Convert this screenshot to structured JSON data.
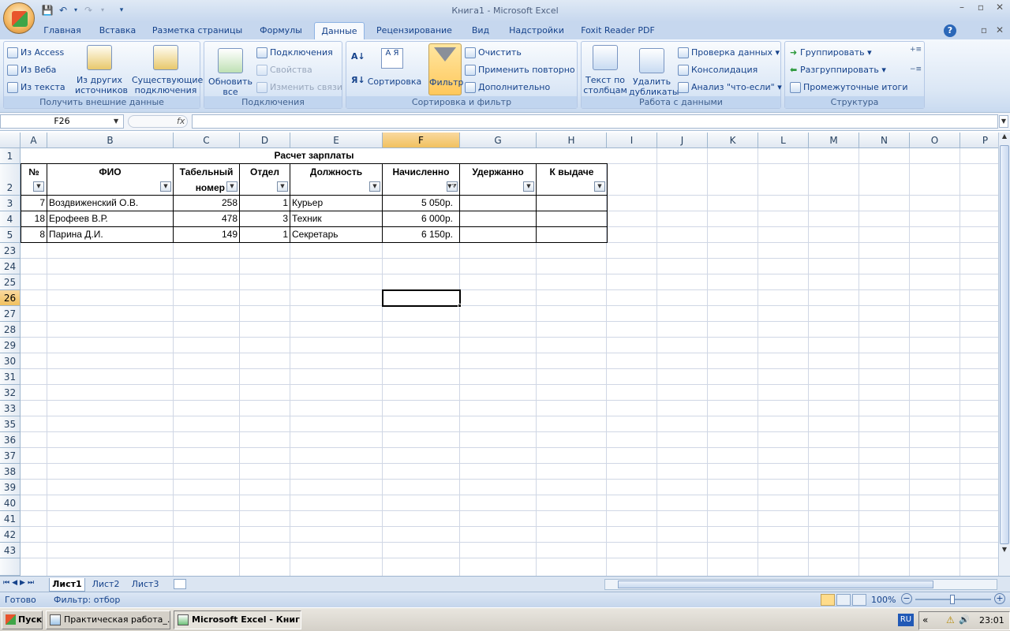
{
  "window": {
    "title": "Книга1 - Microsoft Excel"
  },
  "tabs": [
    "Главная",
    "Вставка",
    "Разметка страницы",
    "Формулы",
    "Данные",
    "Рецензирование",
    "Вид",
    "Надстройки",
    "Foxit Reader PDF"
  ],
  "active_tab": "Данные",
  "ribbon": {
    "ext": {
      "label": "Получить внешние данные",
      "access": "Из Access",
      "web": "Из Веба",
      "text": "Из текста",
      "other1": "Из других",
      "other2": "источников",
      "existing1": "Существующие",
      "existing2": "подключения"
    },
    "conn": {
      "label": "Подключения",
      "refresh1": "Обновить",
      "refresh2": "все",
      "connections": "Подключения",
      "props": "Свойства",
      "edit": "Изменить связи"
    },
    "sort": {
      "label": "Сортировка и фильтр",
      "az": "А Я",
      "sort": "Сортировка",
      "filter": "Фильтр",
      "clear": "Очистить",
      "reapply": "Применить повторно",
      "advanced": "Дополнительно"
    },
    "tools": {
      "label": "Работа с данными",
      "t2c1": "Текст по",
      "t2c2": "столбцам",
      "dup1": "Удалить",
      "dup2": "дубликаты",
      "validate": "Проверка данных",
      "consolidate": "Консолидация",
      "whatif": "Анализ \"что-если\""
    },
    "outline": {
      "label": "Структура",
      "group": "Группировать",
      "ungroup": "Разгруппировать",
      "subtotal": "Промежуточные итоги"
    }
  },
  "formula_bar": {
    "name_box": "F26",
    "fx": "fx",
    "value": ""
  },
  "columns": [
    "A",
    "B",
    "C",
    "D",
    "E",
    "F",
    "G",
    "H",
    "I",
    "J",
    "K",
    "L",
    "M",
    "N",
    "O",
    "P"
  ],
  "rows": [
    "1",
    "2",
    "3",
    "4",
    "5",
    "23",
    "24",
    "25",
    "26",
    "27",
    "28",
    "29",
    "30",
    "31",
    "32",
    "33",
    "35",
    "36",
    "37",
    "38",
    "39",
    "40",
    "41",
    "42",
    "43"
  ],
  "sheet": {
    "title": "Расчет зарплаты",
    "headers": {
      "no": "№",
      "fio": "ФИО",
      "tab1": "Табельный",
      "tab2": "номер",
      "dept": "Отдел",
      "pos": "Должность",
      "accr": "Начисленно",
      "held": "Удержанно",
      "pay": "К выдаче"
    },
    "data": [
      {
        "no": "7",
        "fio": "Воздвиженский О.В.",
        "tab": "258",
        "dept": "1",
        "pos": "Курьер",
        "accr": "5 050р."
      },
      {
        "no": "18",
        "fio": "Ерофеев В.Р.",
        "tab": "478",
        "dept": "3",
        "pos": "Техник",
        "accr": "6 000р."
      },
      {
        "no": "8",
        "fio": "Парина Д.И.",
        "tab": "149",
        "dept": "1",
        "pos": "Секретарь",
        "accr": "6 150р."
      }
    ]
  },
  "sheet_tabs": [
    "Лист1",
    "Лист2",
    "Лист3"
  ],
  "status": {
    "ready": "Готово",
    "filter": "Фильтр: отбор",
    "zoom": "100%",
    "minus": "−",
    "plus": "+"
  },
  "taskbar": {
    "start": "Пуск",
    "task1": "Практическая работа_...",
    "task2": "Microsoft Excel - Книг...",
    "lang": "RU",
    "arrows": "«",
    "time": "23:01"
  }
}
